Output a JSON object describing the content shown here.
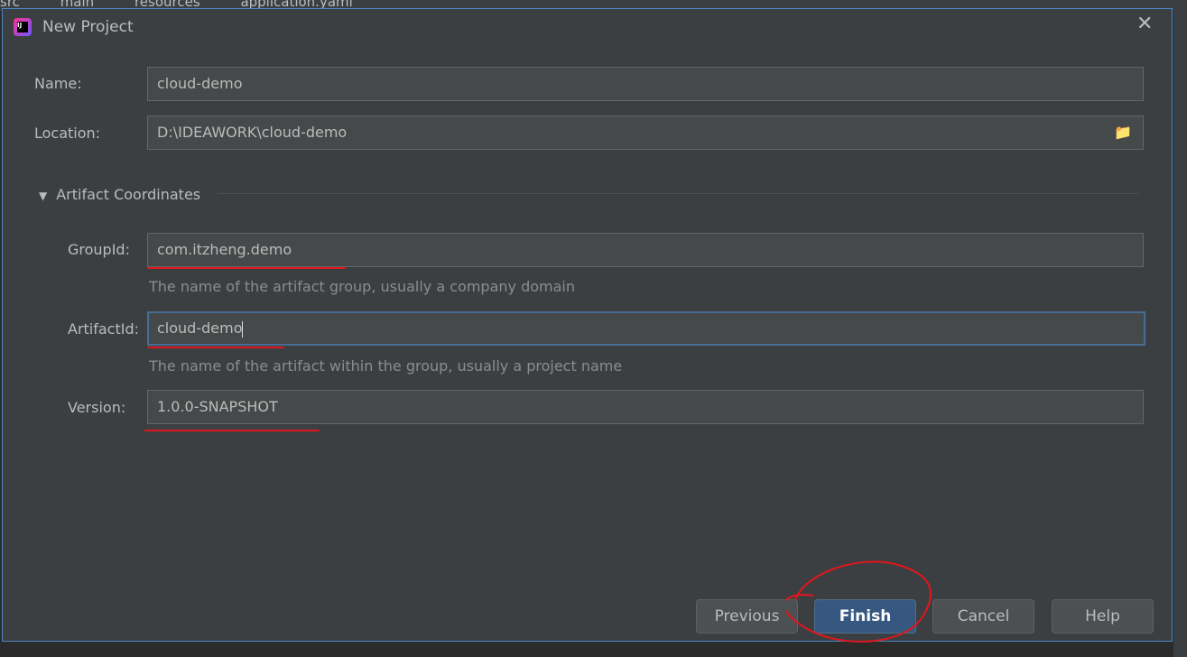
{
  "breadcrumb": [
    "src",
    "main",
    "resources",
    "application.yaml"
  ],
  "dialog": {
    "title": "New Project",
    "close": "✕"
  },
  "form": {
    "name_label": "Name:",
    "name_value": "cloud-demo",
    "location_label": "Location:",
    "location_value": "D:\\IDEAWORK\\cloud-demo",
    "section": "Artifact Coordinates",
    "group_label": "GroupId:",
    "group_value": "com.itzheng.demo",
    "group_hint": "The name of the artifact group, usually a company domain",
    "artifact_label": "ArtifactId:",
    "artifact_value": "cloud-demo",
    "artifact_hint": "The name of the artifact within the group, usually a project name",
    "version_label": "Version:",
    "version_value": "1.0.0-SNAPSHOT"
  },
  "buttons": {
    "previous": "Previous",
    "finish": "Finish",
    "cancel": "Cancel",
    "help": "Help"
  },
  "colors": {
    "annotation": "#e0161d",
    "primary": "#365880"
  }
}
